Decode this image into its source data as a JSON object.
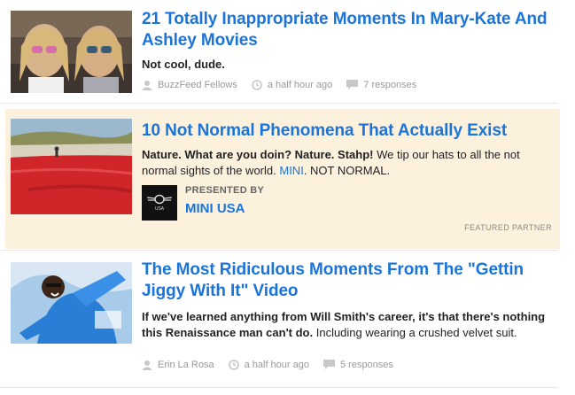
{
  "stories": [
    {
      "title": "21 Totally Inappropriate Moments In Mary-Kate And Ashley Movies",
      "description_bold": "Not cool, dude.",
      "author": "BuzzFeed Fellows",
      "time": "a half hour ago",
      "responses": "7 responses"
    },
    {
      "title": "10 Not Normal Phenomena That Actually Exist",
      "description_bold": "Nature. What are you doin? Nature. Stahp!",
      "description_text": " We tip our hats to all the not normal sights of the world. ",
      "description_link": "MINI",
      "description_tail": ". NOT NORMAL.",
      "presented_by_label": "PRESENTED BY",
      "presenter_name": "MINI USA",
      "presenter_logo_text": "USA",
      "featured_label": "FEATURED PARTNER"
    },
    {
      "title": "The Most Ridiculous Moments From The \"Gettin Jiggy With It\" Video",
      "description_bold": "If we've learned anything from Will Smith's career, it's that there's nothing this Renaissance man can't do.",
      "description_text": " Including wearing a crushed velvet suit.",
      "author": "Erin La Rosa",
      "time": "a half hour ago",
      "responses": "5 responses"
    }
  ],
  "colors": {
    "link": "#1a74d9",
    "featured_bg": "#fcf1dc",
    "meta": "#999999"
  }
}
